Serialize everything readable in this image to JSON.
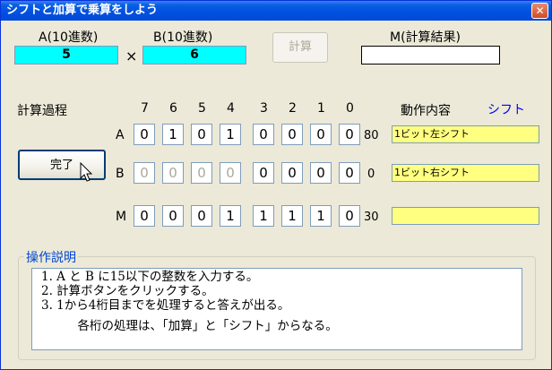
{
  "window": {
    "title": "シフトと加算で乗算をしよう",
    "close_glyph": "✕"
  },
  "inputs": {
    "a_label": "A(10進数)",
    "a_value": "5",
    "times": "×",
    "b_label": "B(10進数)",
    "b_value": "6",
    "calc_button": "計算",
    "result_label": "M(計算結果)",
    "result_value": ""
  },
  "process": {
    "label": "計算過程",
    "done_button": "完了",
    "bit_headers": [
      "7",
      "6",
      "5",
      "4",
      "3",
      "2",
      "1",
      "0"
    ],
    "action_header": "動作内容",
    "shift_header": "シフト",
    "shift_color": "#0000ff",
    "rows": [
      {
        "name": "A",
        "bits": [
          "0",
          "1",
          "0",
          "1",
          "0",
          "0",
          "0",
          "0"
        ],
        "decimal": "80",
        "action": "1ビット左シフト"
      },
      {
        "name": "B",
        "bits": [
          "0",
          "0",
          "0",
          "0",
          "0",
          "0",
          "0",
          "0"
        ],
        "decimal": "0",
        "action": "1ビット右シフト"
      },
      {
        "name": "M",
        "bits": [
          "0",
          "0",
          "0",
          "1",
          "1",
          "1",
          "1",
          "0"
        ],
        "decimal": "30",
        "action": ""
      }
    ]
  },
  "help": {
    "title": "操作説明",
    "lines": [
      "1. A と B に15以下の整数を入力する。",
      "2. 計算ボタンをクリックする。",
      "3. 1から4桁目までを処理すると答えが出る。",
      "　　　各桁の処理は、「加算」と「シフト」からなる。"
    ]
  },
  "colors": {
    "title_bar": "#0050e0",
    "input_bg": "#00ffff",
    "action_bg": "#ffff80",
    "help_title": "#0046d5"
  }
}
